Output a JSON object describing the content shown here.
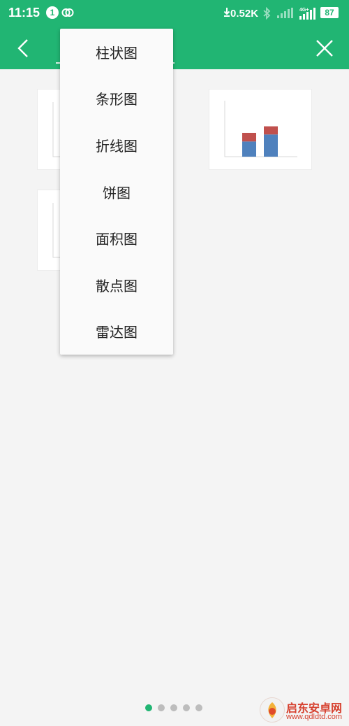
{
  "status_bar": {
    "time": "11:15",
    "notification_count": "1",
    "net_speed": "0.52K",
    "network_type": "4G+",
    "battery": "87",
    "icons": [
      "link-icon",
      "bluetooth-icon",
      "signal-icon",
      "signal-4g-icon",
      "battery-icon"
    ]
  },
  "toolbar": {
    "icons": [
      "back-arrow-icon",
      "close-icon"
    ]
  },
  "chart_menu": {
    "items": [
      {
        "label": "柱状图"
      },
      {
        "label": "条形图"
      },
      {
        "label": "折线图"
      },
      {
        "label": "饼图"
      },
      {
        "label": "面积图"
      },
      {
        "label": "散点图"
      },
      {
        "label": "雷达图"
      }
    ]
  },
  "thumbnails": {
    "stacked_bar": {
      "series_colors": [
        "#4f81bd",
        "#c0504d"
      ],
      "stacks": [
        {
          "lower": 0.52,
          "upper": 0.38
        },
        {
          "lower": 0.76,
          "upper": 0.36
        }
      ]
    }
  },
  "pager": {
    "total_pages": 5,
    "active_index": 0
  },
  "watermark": {
    "title": "启东安卓网",
    "url": "www.qdldtd.com"
  },
  "colors": {
    "accent": "#21b573",
    "background": "#f4f4f4"
  }
}
